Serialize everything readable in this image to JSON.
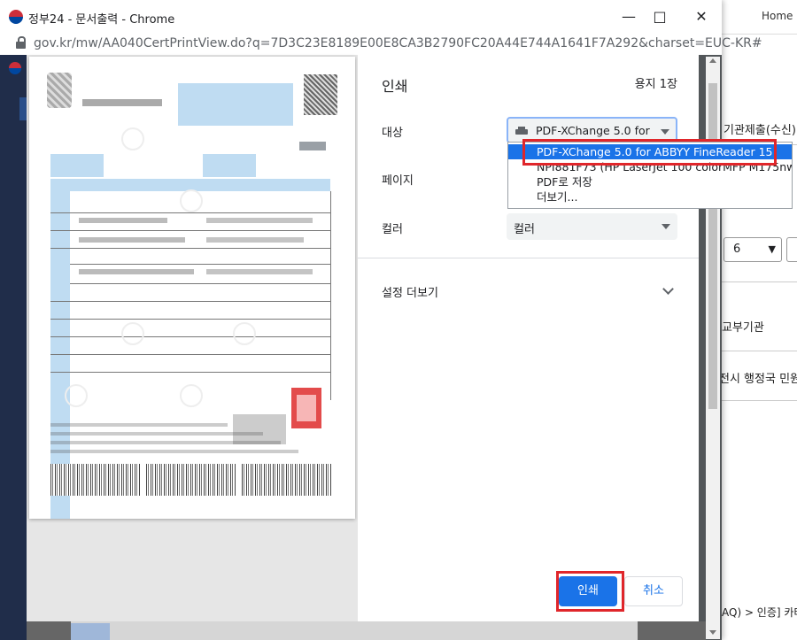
{
  "background_page": {
    "home": "Home",
    "agency_submit": "기관제출(수신)",
    "select_value": "6",
    "issuing_agency": "교부기관",
    "city_office": "전시 행정국 민원",
    "breadcrumb": "AQ) > 인증] 카터"
  },
  "window": {
    "title": "정부24 - 문서출력 - Chrome",
    "url": "gov.kr/mw/AA040CertPrintView.do?q=7D3C23E8189E00E8CA3B2790FC20A44E744A1641F7A292&charset=EUC-KR#"
  },
  "print_dialog": {
    "title": "인쇄",
    "sheet_count": "용지 1장",
    "destination_label": "대상",
    "destination_value": "PDF-XChange 5.0 for ABBYY FineReader 15",
    "pages_label": "페이지",
    "color_label": "컬러",
    "color_value": "컬러",
    "more_settings": "설정 더보기",
    "print_button": "인쇄",
    "cancel_button": "취소",
    "destination_options": [
      "PDF-XChange 5.0 for ABBYY FineReader 15",
      "NPI881F73 (HP LaserJet 100 colorMFP M175nw)",
      "PDF로 저장",
      "더보기..."
    ]
  },
  "icons": [
    "favicon-taegeuk-icon",
    "minimize-icon",
    "maximize-icon",
    "close-icon",
    "lock-icon",
    "printer-icon",
    "dropdown-caret-icon",
    "chevron-down-icon"
  ],
  "colors": {
    "accent": "#1a73e8",
    "highlight_box": "#e0262b",
    "preview_bg": "#e6e6e6"
  }
}
